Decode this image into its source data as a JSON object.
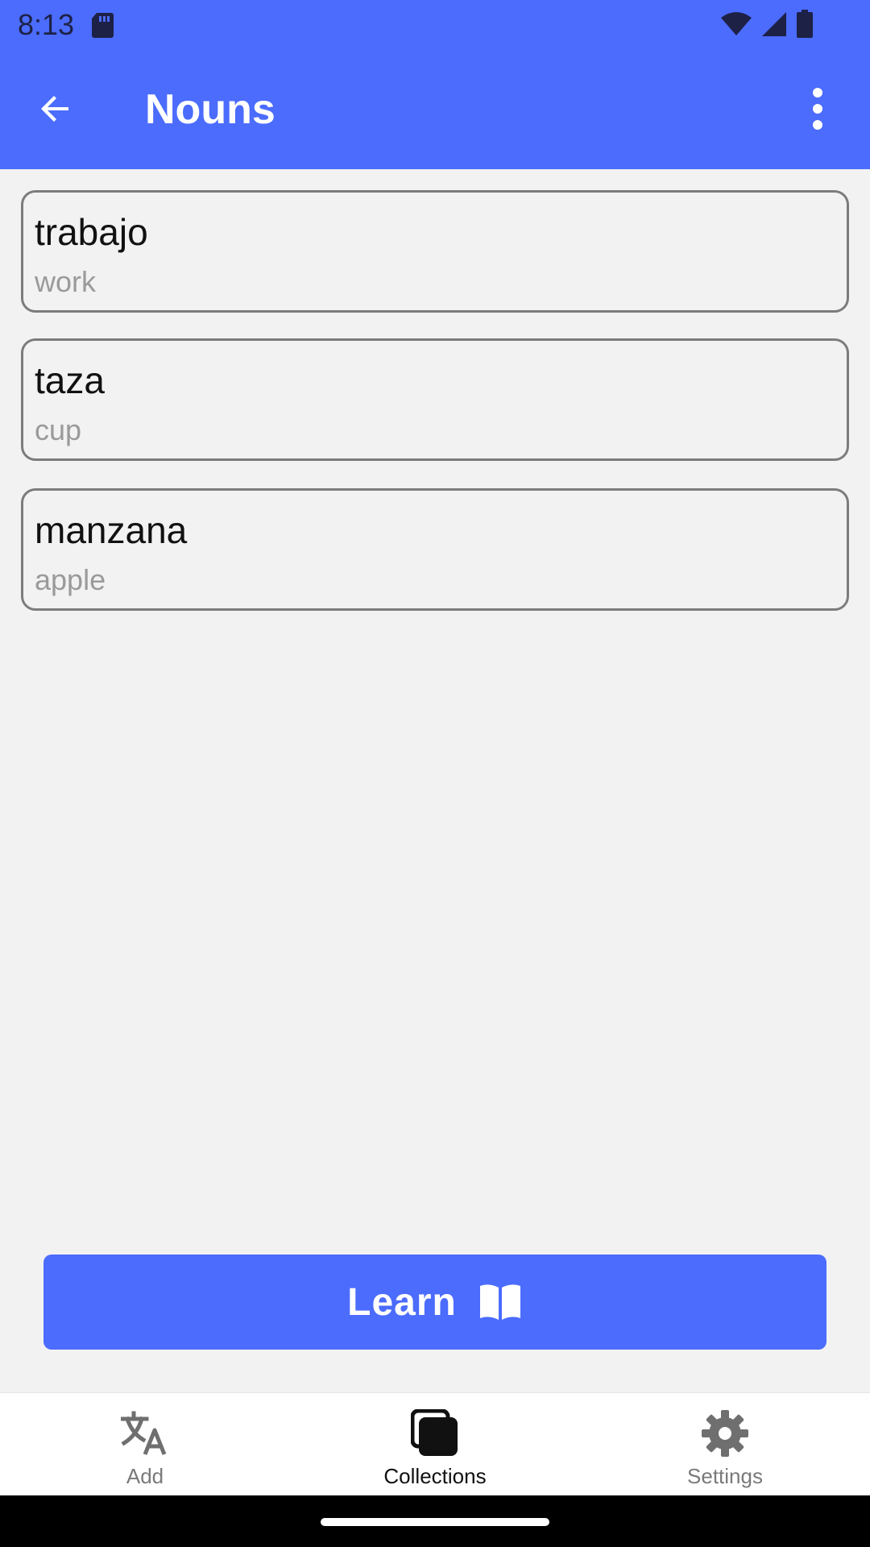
{
  "status_bar": {
    "time": "8:13"
  },
  "app_bar": {
    "title": "Nouns"
  },
  "words": [
    {
      "word": "trabajo",
      "translation": "work"
    },
    {
      "word": "taza",
      "translation": "cup"
    },
    {
      "word": "manzana",
      "translation": "apple"
    }
  ],
  "learn_button": {
    "label": "Learn"
  },
  "bottom_nav": {
    "items": [
      {
        "label": "Add",
        "icon": "translate-icon",
        "active": false
      },
      {
        "label": "Collections",
        "icon": "collections-icon",
        "active": true
      },
      {
        "label": "Settings",
        "icon": "gear-icon",
        "active": false
      }
    ]
  },
  "colors": {
    "accent": "#4b6cfd",
    "background": "#f2f2f2"
  }
}
